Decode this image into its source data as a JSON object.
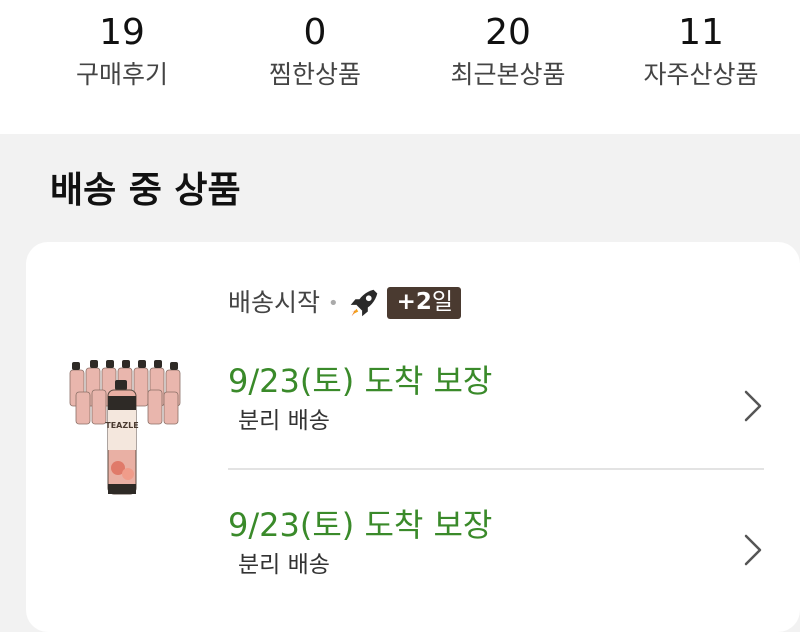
{
  "stats": [
    {
      "value": "19",
      "label": "구매후기"
    },
    {
      "value": "0",
      "label": "찜한상품"
    },
    {
      "value": "20",
      "label": "최근본상품"
    },
    {
      "value": "11",
      "label": "자주산상품"
    }
  ],
  "section": {
    "title": "배송 중 상품"
  },
  "shipping": {
    "status": "배송시작",
    "badge_prefix": "+2",
    "badge_suffix": "일",
    "icon": "rocket-icon",
    "entries": [
      {
        "date": "9/23(토) 도착 보장",
        "method": "분리 배송"
      },
      {
        "date": "9/23(토) 도착 보장",
        "method": "분리 배송"
      }
    ]
  },
  "product": {
    "brand_text": "TEAZLE"
  },
  "colors": {
    "arrival_green": "#3a8a2a",
    "badge_brown": "#4a3a30"
  }
}
